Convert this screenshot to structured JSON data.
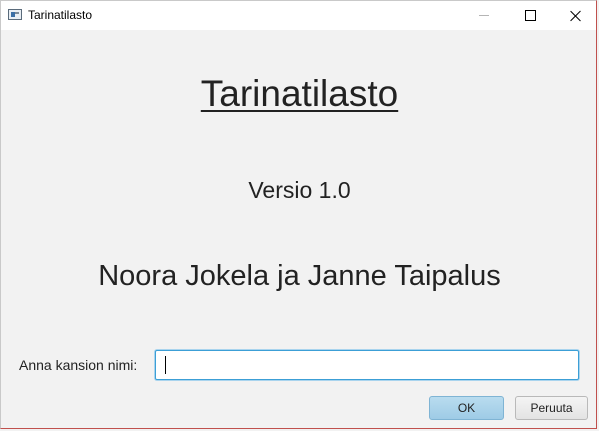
{
  "window": {
    "title": "Tarinatilasto",
    "icon": "application-window-icon",
    "controls": [
      "minimize-icon",
      "maximize-icon",
      "close-icon"
    ]
  },
  "content": {
    "app_title": "Tarinatilasto",
    "version": "Versio 1.0",
    "authors": "Noora Jokela ja Janne Taipalus"
  },
  "form": {
    "folder_label": "Anna kansion nimi:",
    "folder_value": "",
    "folder_placeholder": ""
  },
  "buttons": {
    "ok_label": "OK",
    "cancel_label": "Peruuta"
  },
  "colors": {
    "background": "#f2f2f2",
    "input_focus_border": "#3c9fd6",
    "ok_button": "#9ecbe6"
  }
}
